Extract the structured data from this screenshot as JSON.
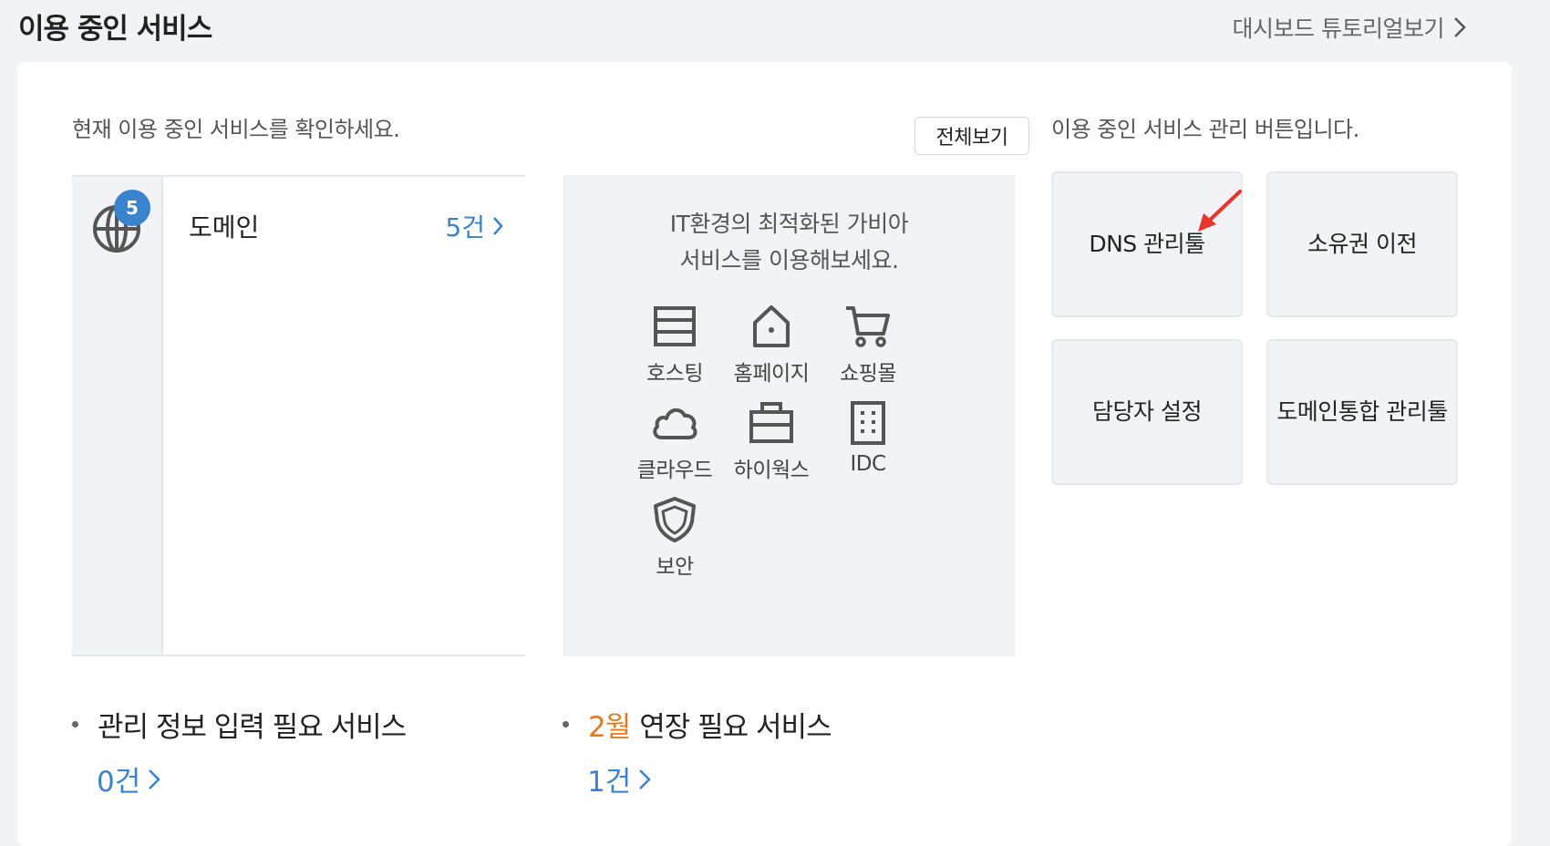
{
  "header": {
    "title": "이용 중인 서비스",
    "tutorial_label": "대시보드 튜토리얼보기"
  },
  "services": {
    "description": "현재 이용 중인 서비스를 확인하세요.",
    "view_all_label": "전체보기",
    "domain": {
      "badge": "5",
      "label": "도메인",
      "count": "5건"
    }
  },
  "promo": {
    "line1": "IT환경의 최적화된 가비아",
    "line2": "서비스를 이용해보세요.",
    "items": [
      {
        "label": "호스팅",
        "icon": "hosting-icon"
      },
      {
        "label": "홈페이지",
        "icon": "homepage-icon"
      },
      {
        "label": "쇼핑몰",
        "icon": "cart-icon"
      },
      {
        "label": "클라우드",
        "icon": "cloud-icon"
      },
      {
        "label": "하이웍스",
        "icon": "briefcase-icon"
      },
      {
        "label": "IDC",
        "icon": "building-icon"
      },
      {
        "label": "보안",
        "icon": "shield-icon"
      }
    ]
  },
  "management": {
    "description": "이용 중인 서비스 관리 버튼입니다.",
    "buttons": {
      "dns": "DNS 관리툴",
      "ownership": "소유권 이전",
      "contact": "담당자 설정",
      "domain_line1": "도메인",
      "domain_line2": "통합 관리툴"
    }
  },
  "summary": {
    "info_needed_label": "관리 정보 입력 필요 서비스",
    "info_needed_count": "0건",
    "renewal_month": "2월",
    "renewal_label": "연장 필요 서비스",
    "renewal_count": "1건"
  },
  "colors": {
    "accent_blue": "#3a83cf",
    "accent_orange": "#e47a1c",
    "annotation_red": "#e8352a"
  }
}
